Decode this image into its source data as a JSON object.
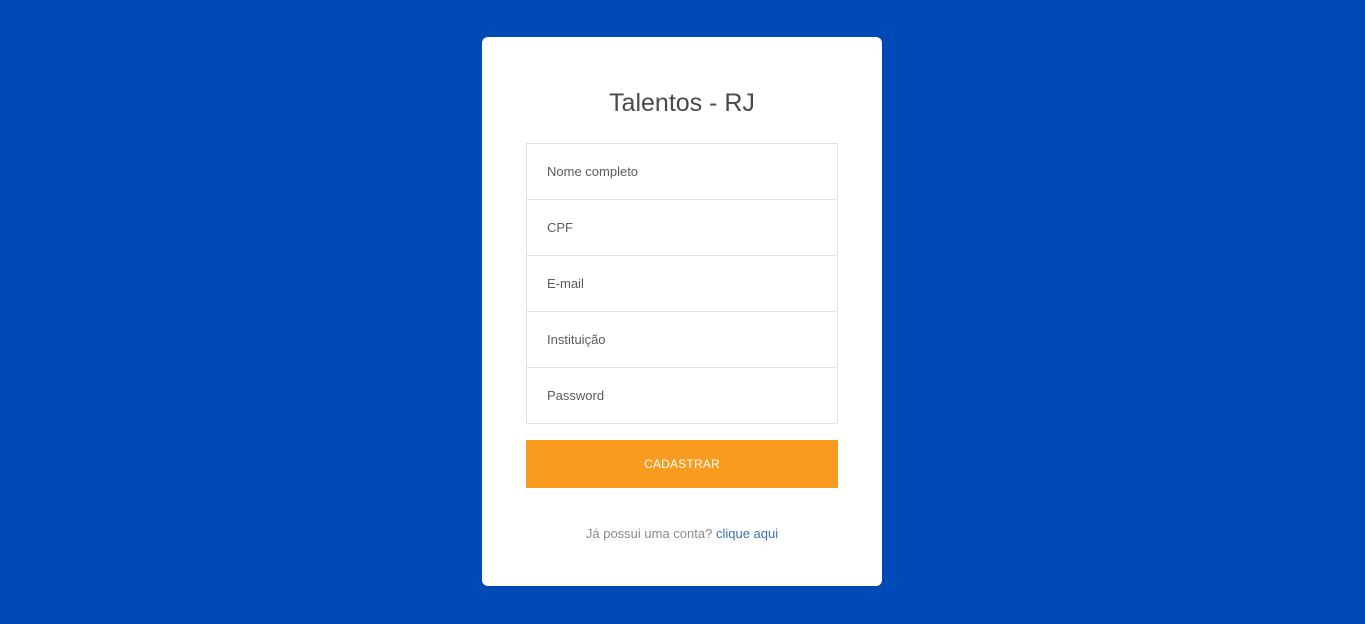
{
  "form": {
    "title": "Talentos - RJ",
    "fields": [
      {
        "placeholder": "Nome completo",
        "value": ""
      },
      {
        "placeholder": "CPF",
        "value": ""
      },
      {
        "placeholder": "E-mail",
        "value": ""
      },
      {
        "placeholder": "Instituição",
        "value": ""
      },
      {
        "placeholder": "Password",
        "value": ""
      }
    ],
    "submit_label": "CADASTRAR",
    "login_prompt": "Já possui uma conta?",
    "login_link": "clique aqui"
  },
  "colors": {
    "background": "#004AB5",
    "card": "#FFFFFF",
    "button": "#F89B1E",
    "link": "#3B6FB6"
  }
}
